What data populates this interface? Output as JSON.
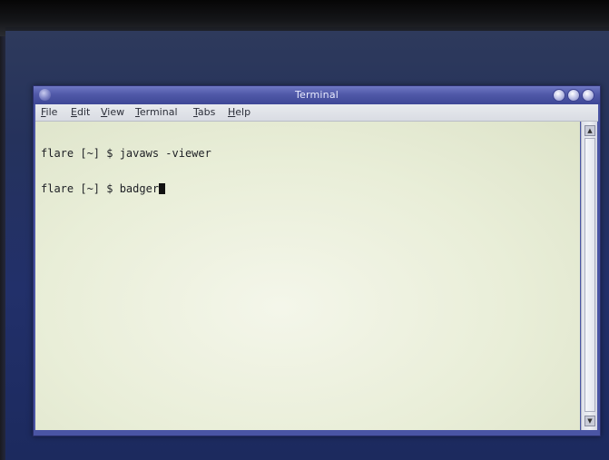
{
  "window": {
    "title": "Terminal",
    "icons": {
      "app": "terminal-app-icon",
      "minimize": "minimize-icon",
      "maximize": "maximize-icon",
      "close": "close-icon"
    }
  },
  "menu": {
    "items": [
      {
        "label": "File"
      },
      {
        "label": "Edit"
      },
      {
        "label": "View"
      },
      {
        "label": "Terminal"
      },
      {
        "label": "Tabs"
      },
      {
        "label": "Help"
      }
    ]
  },
  "terminal": {
    "lines": [
      "flare [~] $ javaws -viewer",
      "flare [~] $ badger"
    ]
  },
  "scrollbar": {
    "up_icon": "arrow-up-icon",
    "down_icon": "arrow-down-icon"
  },
  "colors": {
    "titlebar": "#5059a8",
    "menubar": "#d9dce3",
    "terminal_background": "#eef1e0",
    "terminal_text": "#1d1f24",
    "desktop": "#22306a"
  }
}
